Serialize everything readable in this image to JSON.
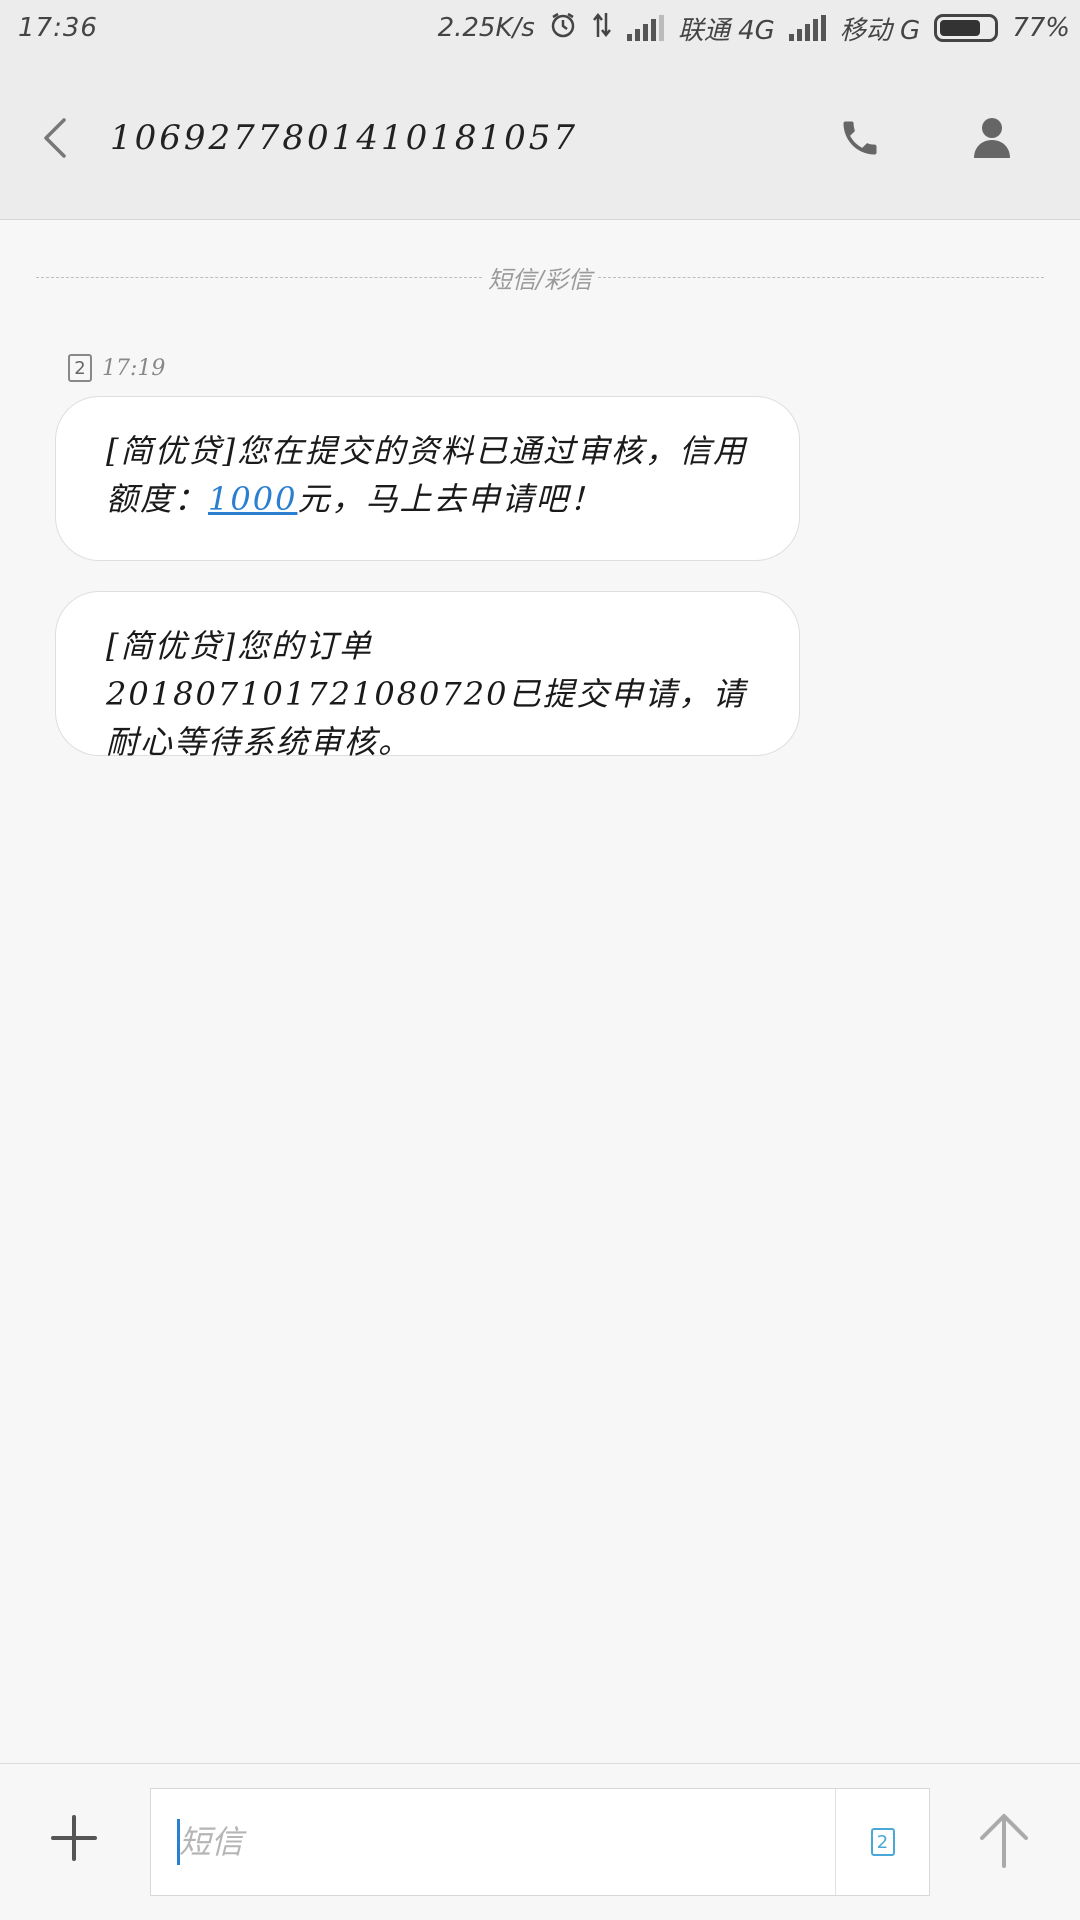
{
  "status_bar": {
    "time": "17:36",
    "network_speed": "2.25K/s",
    "carrier_1": "联通 4G",
    "carrier_2": "移动 G",
    "battery": "77%",
    "battery_level": 0.77,
    "icons": [
      "alarm-icon",
      "data-transfer-icon",
      "signal-icon",
      "battery-icon"
    ]
  },
  "header": {
    "contact_number": "1069277801410181057",
    "icons": [
      "back-arrow-icon",
      "phone-icon",
      "person-icon"
    ]
  },
  "conversation": {
    "channel_label": "短信/彩信",
    "meta": {
      "sim": "2",
      "time": "17:19"
    },
    "messages": [
      {
        "text_before": "[简优贷]您在提交的资料已通过审核，信用额度：",
        "link": "1000",
        "text_after": "元，马上去申请吧！"
      },
      {
        "text": "[简优贷]您的订单201807101721080720已提交申请，请耐心等待系统审核。"
      }
    ]
  },
  "composer": {
    "placeholder": "短信",
    "value": "",
    "sim": "2",
    "icons": [
      "plus-icon",
      "sim-card-icon",
      "send-arrow-icon"
    ]
  },
  "colors": {
    "background": "#f7f7f7",
    "header": "#ececec",
    "link": "#2b7fd0",
    "sim_accent": "#4aa8d8"
  }
}
